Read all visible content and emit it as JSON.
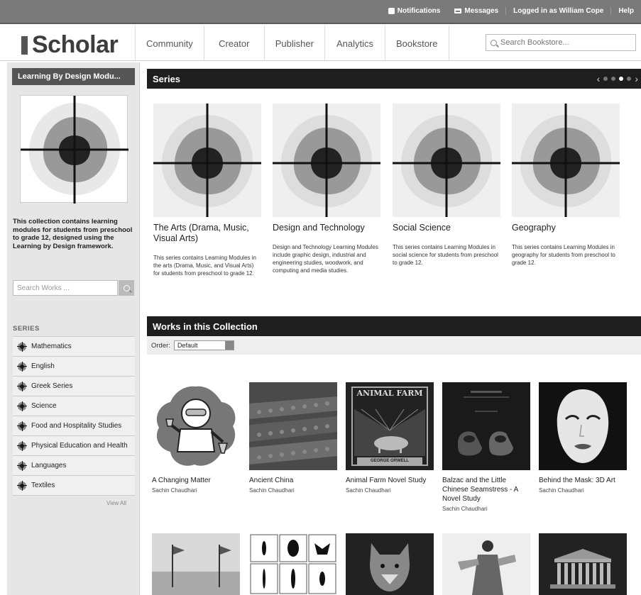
{
  "topbar": {
    "notifications": "Notifications",
    "messages": "Messages",
    "logged_in": "Logged in as William Cope",
    "help": "Help"
  },
  "header": {
    "logo": "Scholar",
    "nav": [
      "Community",
      "Creator",
      "Publisher",
      "Analytics",
      "Bookstore"
    ],
    "search_placeholder": "Search Bookstore..."
  },
  "sidebar": {
    "collection_title": "Learning By Design Modu...",
    "description": "This collection contains learning modules for students from preschool to grade 12, designed using the Learning by Design framework.",
    "search_placeholder": "Search Works ...",
    "series_heading": "SERIES",
    "series": [
      "Mathematics",
      "English",
      "Greek Series",
      "Science",
      "Food and Hospitality Studies",
      "Physical Education and Health",
      "Languages",
      "Textiles"
    ],
    "view_all": "View All"
  },
  "series_section": {
    "heading": "Series",
    "cards": [
      {
        "title": "The Arts (Drama, Music, Visual Arts)",
        "desc": "This series contains Learning Modules in the arts (Drama, Music, and Visual Arts) for students from preschool to grade 12."
      },
      {
        "title": "Design and Technology",
        "desc": "Design and Technology Learning Modules include graphic design, industrial and engineering studies, woodwork, and computing and media studies."
      },
      {
        "title": "Social Science",
        "desc": "This series contains Learning Modules in social science for students from preschool to grade 12."
      },
      {
        "title": "Geography",
        "desc": "This series contains Learning Modules in geography for students from preschool to grade 12."
      }
    ]
  },
  "works_section": {
    "heading": "Works in this Collection",
    "order_label": "Order:",
    "order_value": "Default",
    "works": [
      {
        "title": "A Changing Matter",
        "author": "Sachin Chaudhari"
      },
      {
        "title": "Ancient China",
        "author": "Sachin Chaudhari"
      },
      {
        "title": "Animal Farm Novel Study",
        "author": "Sachin Chaudhari",
        "cover_text_top": "ANIMAL FARM",
        "cover_text_bottom": "GEORGE ORWELL"
      },
      {
        "title": "Balzac and the Little Chinese Seamstress - A Novel Study",
        "author": "Sachin Chaudhari"
      },
      {
        "title": "Behind the Mask: 3D Art",
        "author": "Sachin Chaudhari"
      }
    ]
  }
}
